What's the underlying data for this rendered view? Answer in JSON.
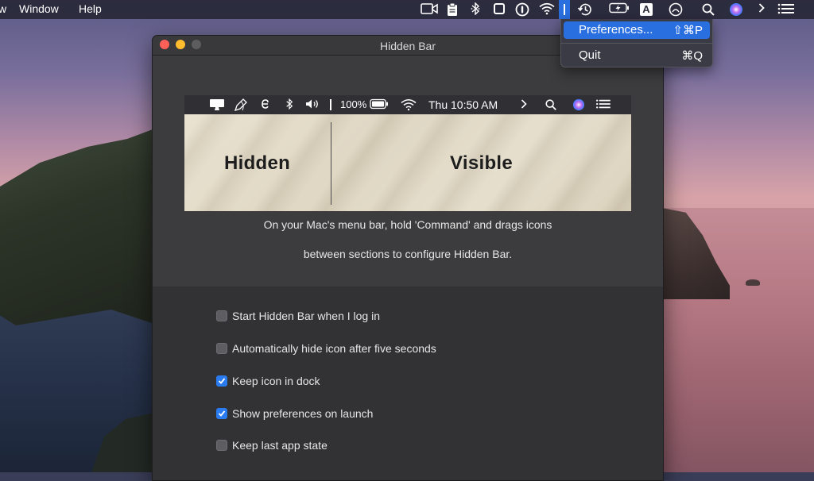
{
  "menubar": {
    "left_items": [
      "w",
      "Window",
      "Help"
    ],
    "icons": [
      "camera-icon",
      "clipboard-icon",
      "bluetooth-icon",
      "square-icon",
      "onepassword-icon",
      "wifi-icon",
      "hidden-bar-icon",
      "time-machine-icon",
      "battery-icon",
      "input-source-icon",
      "gauge-icon",
      "search-icon",
      "siri-icon",
      "chevron-right-icon",
      "list-icon"
    ],
    "input_source_label": "A"
  },
  "dropdown": {
    "items": [
      {
        "label": "Preferences...",
        "shortcut": "⇧⌘P",
        "selected": true
      },
      {
        "label": "Quit",
        "shortcut": "⌘Q",
        "selected": false
      }
    ]
  },
  "window": {
    "title": "Hidden Bar",
    "illustration": {
      "menubar_battery": "100%",
      "menubar_clock": "Thu 10:50 AM",
      "hidden_label": "Hidden",
      "visible_label": "Visible"
    },
    "instructions": [
      "On your Mac's menu bar, hold 'Command' and drags icons",
      "between sections to configure Hidden Bar."
    ],
    "options": [
      {
        "label": "Start Hidden Bar when I log in",
        "checked": false
      },
      {
        "label": "Automatically hide icon after five seconds",
        "checked": false
      },
      {
        "label": "Keep icon in dock",
        "checked": true
      },
      {
        "label": "Show  preferences on launch",
        "checked": true
      },
      {
        "label": "Keep last app state",
        "checked": false
      }
    ]
  },
  "colors": {
    "accent": "#2a6fe0",
    "checkbox_on": "#2a7bf0",
    "window_bg": "#3a3a3c"
  }
}
